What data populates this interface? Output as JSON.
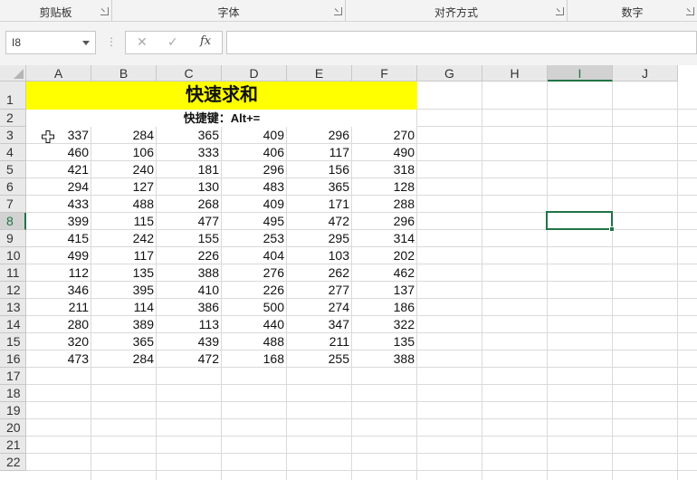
{
  "ribbon": {
    "groups": [
      {
        "label": "剪贴板"
      },
      {
        "label": "字体"
      },
      {
        "label": "对齐方式"
      },
      {
        "label": "数字"
      }
    ]
  },
  "formula_bar": {
    "name_box": "I8",
    "cancel_icon": "✕",
    "enter_icon": "✓",
    "fx_label": "fx",
    "formula": ""
  },
  "columns": [
    "A",
    "B",
    "C",
    "D",
    "E",
    "F",
    "G",
    "H",
    "I",
    "J"
  ],
  "selected_column": "I",
  "rows": [
    "1",
    "2",
    "3",
    "4",
    "5",
    "6",
    "7",
    "8",
    "9",
    "10",
    "11",
    "12",
    "13",
    "14",
    "15",
    "16",
    "17",
    "18",
    "19",
    "20",
    "21",
    "22"
  ],
  "selected_row": "8",
  "sheet": {
    "title": "快速求和",
    "subtitle": "快捷键：Alt+=",
    "title_fill": "#ffff00",
    "data": [
      [
        337,
        284,
        365,
        409,
        296,
        270
      ],
      [
        460,
        106,
        333,
        406,
        117,
        490
      ],
      [
        421,
        240,
        181,
        296,
        156,
        318
      ],
      [
        294,
        127,
        130,
        483,
        365,
        128
      ],
      [
        433,
        488,
        268,
        409,
        171,
        288
      ],
      [
        399,
        115,
        477,
        495,
        472,
        296
      ],
      [
        415,
        242,
        155,
        253,
        295,
        314
      ],
      [
        499,
        117,
        226,
        404,
        103,
        202
      ],
      [
        112,
        135,
        388,
        276,
        262,
        462
      ],
      [
        346,
        395,
        410,
        226,
        277,
        137
      ],
      [
        211,
        114,
        386,
        500,
        274,
        186
      ],
      [
        280,
        389,
        113,
        440,
        347,
        322
      ],
      [
        320,
        365,
        439,
        488,
        211,
        135
      ],
      [
        473,
        284,
        472,
        168,
        255,
        388
      ]
    ]
  },
  "accent_color": "#217346"
}
